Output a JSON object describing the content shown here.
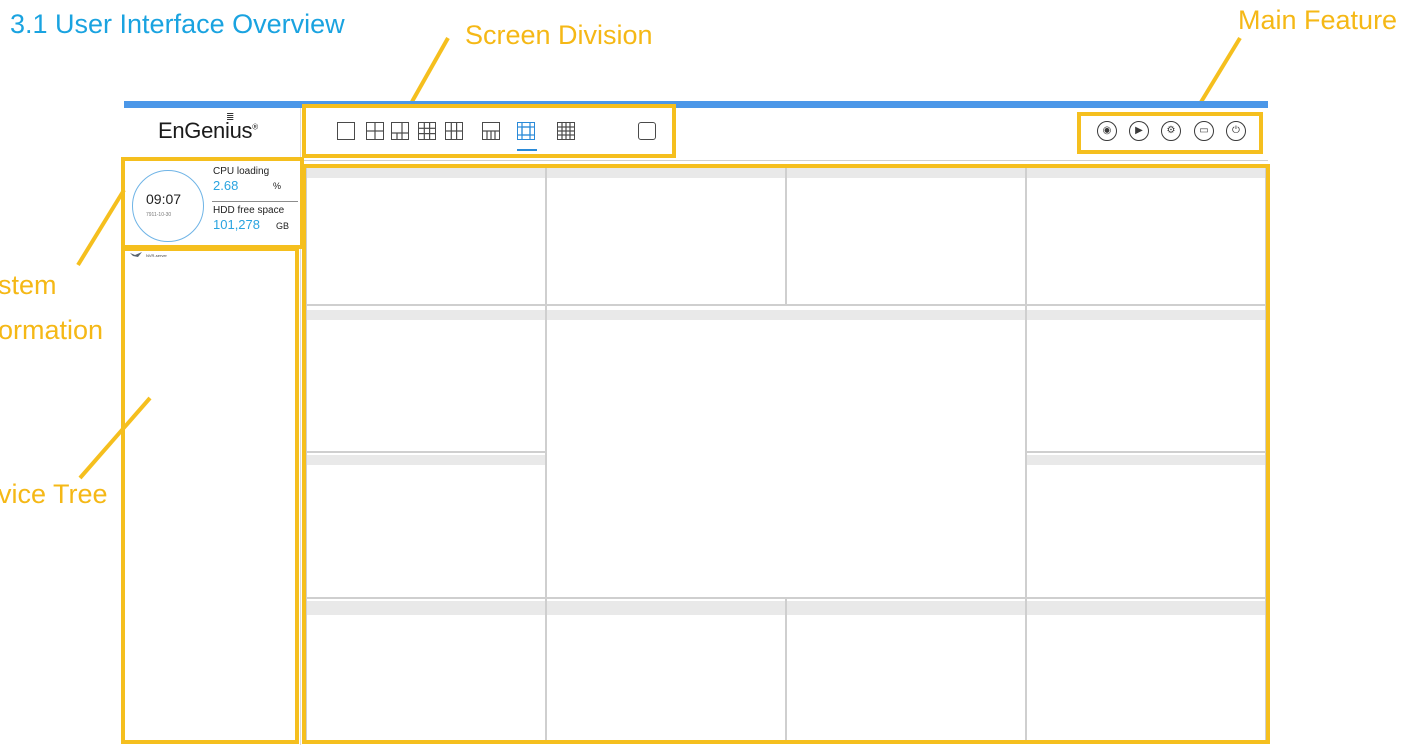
{
  "heading": "3.1 User Interface Overview",
  "callouts": {
    "screen_division": "Screen Division",
    "main_feature": "Main Feature",
    "system_information_line1": "stem",
    "system_information_line2": "ormation",
    "device_tree": "vice Tree"
  },
  "app": {
    "logo": "EnGenius",
    "logo_mark": "®",
    "system": {
      "time": "09:07",
      "date": "7911-10-30",
      "cpu_label": "CPU loading",
      "cpu_value": "2.68",
      "cpu_unit": "%",
      "hdd_label": "HDD free space",
      "hdd_value": "101,278",
      "hdd_unit": "GB"
    },
    "device_tree": {
      "root_label": "NVR-server"
    },
    "screen_division": {
      "layouts": [
        "1-view",
        "4-view",
        "6-view",
        "9-view",
        "8-view",
        "13-view",
        "16-view"
      ],
      "active_layout": "13-view",
      "extra": "fullscreen"
    },
    "main_features": [
      "location-icon",
      "playback-icon",
      "settings-icon",
      "display-icon",
      "power-icon"
    ],
    "accent_color": "#4b97e8",
    "highlight_color": "#f5bf1e"
  }
}
